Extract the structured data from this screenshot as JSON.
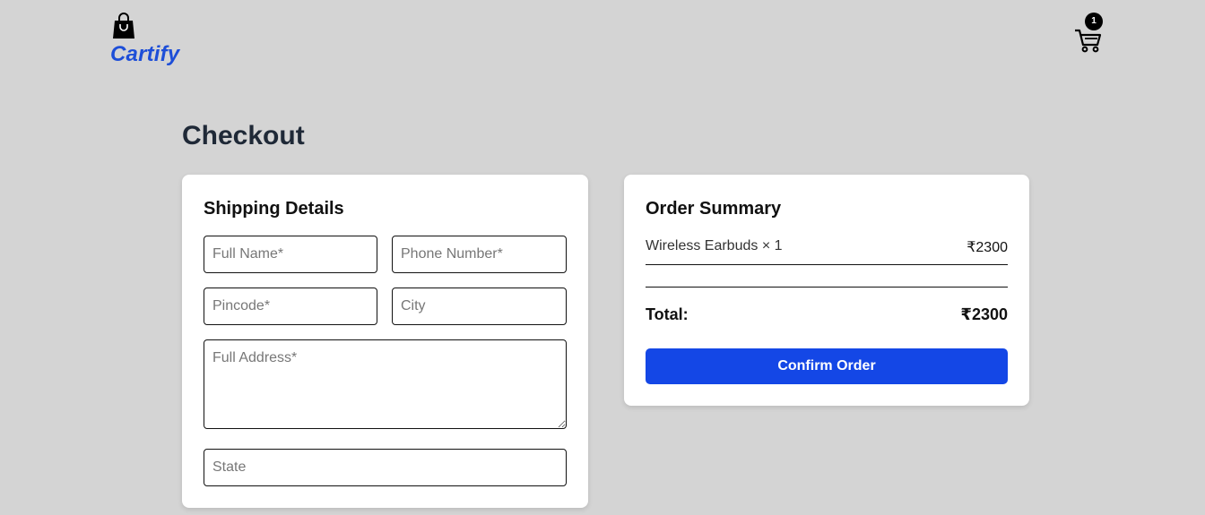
{
  "header": {
    "brand_name": "Cartify",
    "brand_icon": "shopping-bag-icon",
    "cart_icon": "shopping-cart-icon",
    "cart_count": "1",
    "brand_color": "#1d4ed8"
  },
  "page": {
    "title": "Checkout"
  },
  "shipping": {
    "title": "Shipping Details",
    "fields": {
      "full_name": {
        "value": "",
        "placeholder": "Full Name*"
      },
      "phone": {
        "value": "",
        "placeholder": "Phone Number*"
      },
      "pincode": {
        "value": "",
        "placeholder": "Pincode*"
      },
      "city": {
        "value": "",
        "placeholder": "City"
      },
      "address": {
        "value": "",
        "placeholder": "Full Address*"
      },
      "state": {
        "value": "",
        "placeholder": "State"
      }
    }
  },
  "summary": {
    "title": "Order Summary",
    "items": [
      {
        "name": "Wireless Earbuds × 1",
        "price": "₹2300"
      }
    ],
    "total_label": "Total:",
    "total_value": "₹2300",
    "confirm_label": "Confirm Order",
    "button_color": "#1447e6"
  }
}
